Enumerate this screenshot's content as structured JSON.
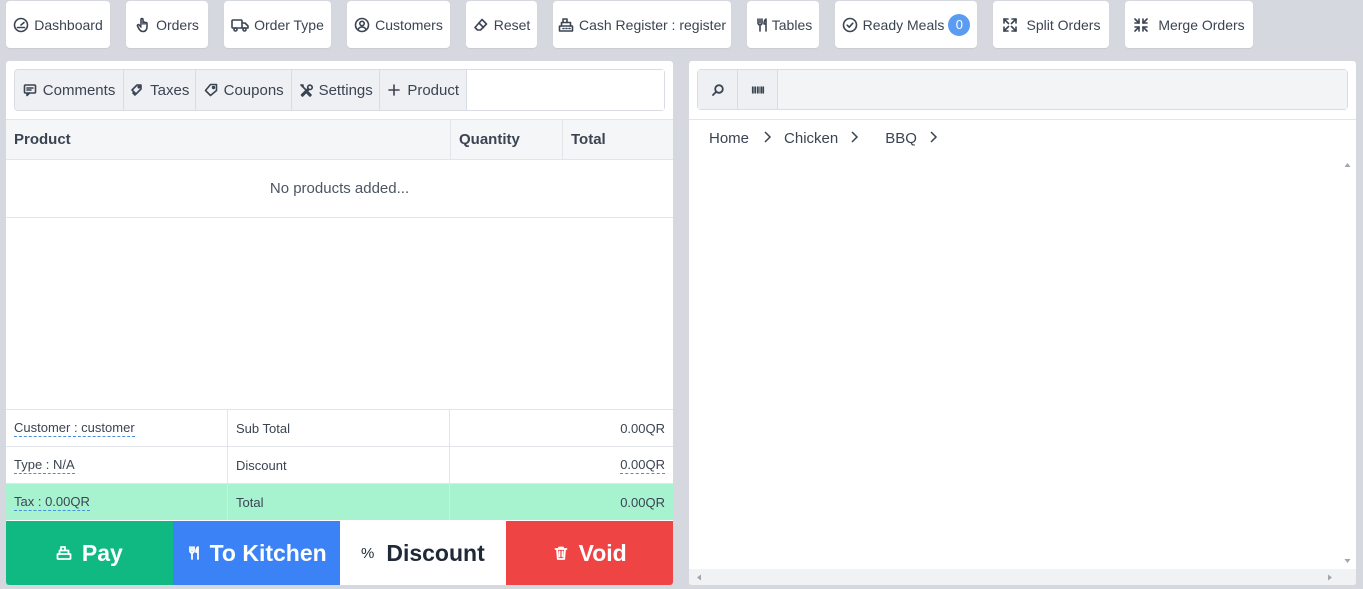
{
  "topbar": {
    "buttons": [
      {
        "label": "Dashboard",
        "icon": "gauge-icon"
      },
      {
        "label": "Orders",
        "icon": "hand-pointer-icon"
      },
      {
        "label": "Order Type",
        "icon": "truck-icon"
      },
      {
        "label": "Customers",
        "icon": "user-circle-icon"
      },
      {
        "label": "Reset",
        "icon": "eraser-icon"
      },
      {
        "label": "Cash Register : register",
        "icon": "cash-register-icon"
      },
      {
        "label": "Tables",
        "icon": "utensils-icon"
      },
      {
        "label": "Ready Meals",
        "icon": "check-circle-icon",
        "badge": "0"
      },
      {
        "label": "Split Orders",
        "icon": "expand-icon"
      },
      {
        "label": "Merge Orders",
        "icon": "compress-icon"
      }
    ]
  },
  "cart": {
    "toolbar": {
      "comments": "Comments",
      "taxes": "Taxes",
      "coupons": "Coupons",
      "settings": "Settings",
      "product": "Product",
      "input_value": ""
    },
    "table": {
      "columns": [
        "Product",
        "Quantity",
        "Total"
      ],
      "empty_message": "No products added..."
    },
    "summary": {
      "customer": "Customer : customer",
      "type": "Type : N/A",
      "tax": "Tax : 0.00QR",
      "subtotal_label": "Sub Total",
      "subtotal_value": "0.00QR",
      "discount_label": "Discount",
      "discount_value": "0.00QR",
      "total_label": "Total",
      "total_value": "0.00QR"
    },
    "actions": {
      "pay": "Pay",
      "kitchen": "To Kitchen",
      "discount_symbol": "%",
      "discount": "Discount",
      "void": "Void"
    },
    "colors": {
      "pay": "#10b981",
      "kitchen": "#3b82f6",
      "void": "#ef4444",
      "total_row": "#a7f3d0",
      "badge": "#5b9cf3"
    }
  },
  "catalog": {
    "search": {
      "value": ""
    },
    "breadcrumbs": [
      "Home",
      "Chicken",
      "BBQ"
    ]
  }
}
